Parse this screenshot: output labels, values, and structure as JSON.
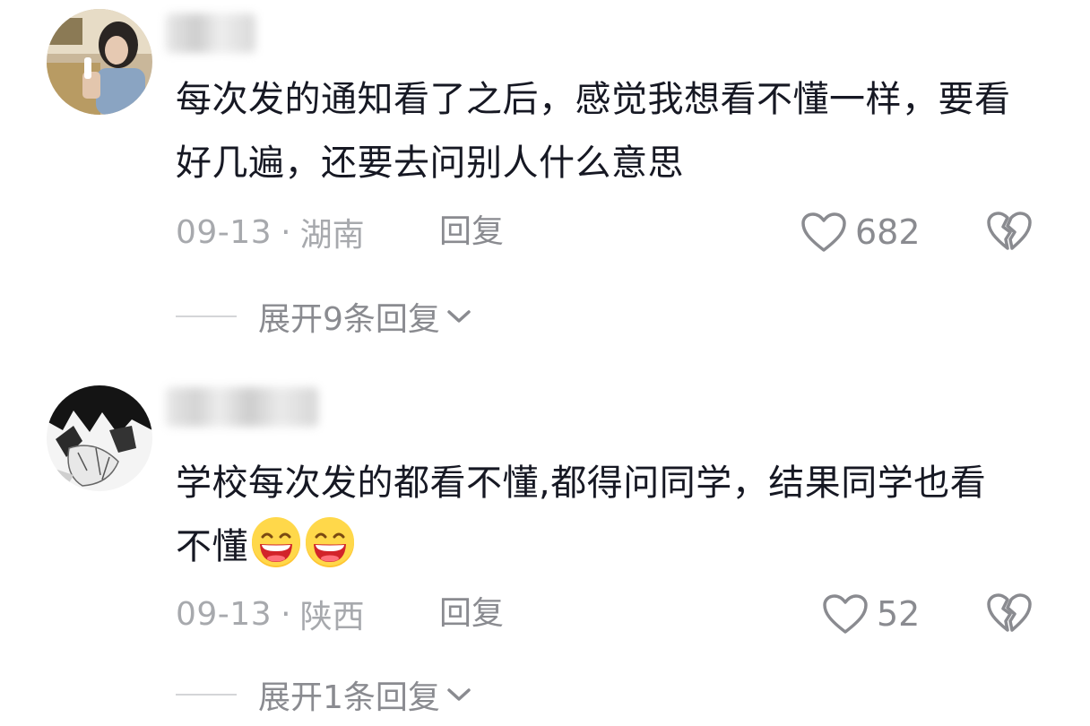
{
  "comments": [
    {
      "text": "每次发的通知看了之后，感觉我想看不懂一样，要看好几遍，还要去问别人什么意思",
      "date": "09-13",
      "location": "湖南",
      "reply_label": "回复",
      "likes": "682",
      "expand_label": "展开9条回复"
    },
    {
      "text": "学校每次发的都看不懂,都得问同学，结果同学也看不懂",
      "emojis": [
        "grin-emoji",
        "grin-emoji"
      ],
      "date": "09-13",
      "location": "陕西",
      "reply_label": "回复",
      "likes": "52",
      "expand_label": "展开1条回复"
    }
  ],
  "colors": {
    "text": "#161823",
    "meta": "#a7a9ad",
    "action": "#8a8b90"
  },
  "icons": {
    "like": "heart-outline-icon",
    "dislike": "broken-heart-icon",
    "expand": "chevron-down-icon"
  }
}
